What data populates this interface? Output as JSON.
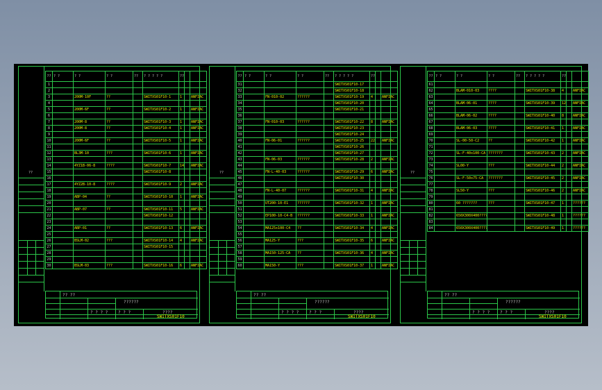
{
  "header": {
    "no": "??",
    "c1": "? ?",
    "c2": "? ?",
    "c3": "? ?",
    "c4": "??",
    "c5": "? ? ? ? ?",
    "c5b": "? ?   ? ?",
    "c6": "?? ??"
  },
  "left_label": "??",
  "title": {
    "name": "??????",
    "sub": "????",
    "code": "SWITXS01F10",
    "row1": "?? ??",
    "row2": "? ? ? ?",
    "row3": "? ? ?"
  },
  "sheets": [
    {
      "rows": [
        {
          "n": "1",
          "a": "",
          "b": "",
          "c": "",
          "d": "",
          "e": ""
        },
        {
          "n": "2",
          "a": "",
          "b": "",
          "c": "",
          "d": "",
          "e": ""
        },
        {
          "n": "3",
          "a": "200M-10F",
          "b": "??",
          "c": "SWITXS01F10-1",
          "d": "1",
          "e": "ANFIAC"
        },
        {
          "n": "4",
          "a": "",
          "b": "",
          "c": "",
          "d": "",
          "e": ""
        },
        {
          "n": "5",
          "a": "200M-6F",
          "b": "??",
          "c": "SWITXS01F10-2",
          "d": "1",
          "e": "ANFIAC"
        },
        {
          "n": "6",
          "a": "",
          "b": "",
          "c": "",
          "d": "",
          "e": ""
        },
        {
          "n": "7",
          "a": "200M-8",
          "b": "??",
          "c": "SWITXS01F10-3",
          "d": "1",
          "e": "ANFIAC"
        },
        {
          "n": "8",
          "a": "200M-8",
          "b": "??",
          "c": "SWITXS01F10-4",
          "d": "1",
          "e": "ANFIAC"
        },
        {
          "n": "9",
          "a": "",
          "b": "",
          "c": "",
          "d": "",
          "e": ""
        },
        {
          "n": "10",
          "a": "200M-6F",
          "b": "??",
          "c": "SWITXS01F10-5",
          "d": "1",
          "e": "ANFIAC"
        },
        {
          "n": "11",
          "a": "",
          "b": "",
          "c": "",
          "d": "",
          "e": ""
        },
        {
          "n": "12",
          "a": "BL3M-10",
          "b": "???",
          "c": "SWITXS01F10-6",
          "d": "1",
          "e": "ANFIAC"
        },
        {
          "n": "13",
          "a": "",
          "b": "",
          "c": "",
          "d": "",
          "e": ""
        },
        {
          "n": "14",
          "a": "4YZ1B-06-8",
          "b": "????",
          "c": "SWITXS01F10-7",
          "d": "14",
          "e": "ANFIAC"
        },
        {
          "n": "15",
          "a": "",
          "b": "",
          "c": "SWITXS01F10-8",
          "d": "",
          "e": ""
        },
        {
          "n": "16",
          "a": "",
          "b": "",
          "c": "",
          "d": "",
          "e": ""
        },
        {
          "n": "17",
          "a": "4YZ2B-10-8",
          "b": "????",
          "c": "SWITXS01F10-9",
          "d": "2",
          "e": "ANFIAC"
        },
        {
          "n": "18",
          "a": "",
          "b": "",
          "c": "",
          "d": "",
          "e": ""
        },
        {
          "n": "19",
          "a": "ABP-04",
          "b": "??",
          "c": "SWITXS01F10-10",
          "d": "1",
          "e": "ANFIAC"
        },
        {
          "n": "20",
          "a": "",
          "b": "",
          "c": "",
          "d": "",
          "e": ""
        },
        {
          "n": "21",
          "a": "ABP-07",
          "b": "??",
          "c": "SWITXS01F10-11",
          "d": "5",
          "e": "ANFIAC"
        },
        {
          "n": "22",
          "a": "",
          "b": "",
          "c": "SWITXS01F10-12",
          "d": "",
          "e": ""
        },
        {
          "n": "23",
          "a": "",
          "b": "",
          "c": "",
          "d": "",
          "e": ""
        },
        {
          "n": "24",
          "a": "ABP-01",
          "b": "??",
          "c": "SWITXS01F10-13",
          "d": "6",
          "e": "ANFIAC"
        },
        {
          "n": "25",
          "a": "",
          "b": "",
          "c": "",
          "d": "",
          "e": ""
        },
        {
          "n": "26",
          "a": "BSLM-02",
          "b": "???",
          "c": "SWITXS01F10-14",
          "d": "4",
          "e": "ANFIAC"
        },
        {
          "n": "27",
          "a": "",
          "b": "",
          "c": "SWITXS01F10-15",
          "d": "",
          "e": ""
        },
        {
          "n": "28",
          "a": "",
          "b": "",
          "c": "",
          "d": "",
          "e": ""
        },
        {
          "n": "29",
          "a": "",
          "b": "",
          "c": "",
          "d": "",
          "e": ""
        },
        {
          "n": "30",
          "a": "BSLM-03",
          "b": "???",
          "c": "SWITXS01F10-16",
          "d": "6",
          "e": "ANFIAC"
        }
      ]
    },
    {
      "rows": [
        {
          "n": "31",
          "a": "",
          "b": "",
          "c": "SWITXS01F10-17",
          "d": "",
          "e": ""
        },
        {
          "n": "32",
          "a": "",
          "b": "",
          "c": "SWITXS01F10-18",
          "d": "",
          "e": ""
        },
        {
          "n": "33",
          "a": "FN-010-02",
          "b": "??????",
          "c": "SWITXS01F10-19",
          "d": "4",
          "e": "ANFIAC"
        },
        {
          "n": "34",
          "a": "",
          "b": "",
          "c": "SWITXS01F10-20",
          "d": "",
          "e": ""
        },
        {
          "n": "35",
          "a": "",
          "b": "",
          "c": "SWITXS01F10-21",
          "d": "",
          "e": ""
        },
        {
          "n": "36",
          "a": "",
          "b": "",
          "c": "",
          "d": "",
          "e": ""
        },
        {
          "n": "37",
          "a": "FN-010-03",
          "b": "??????",
          "c": "SWITXS01F10-22",
          "d": "8",
          "e": "ANFIAC"
        },
        {
          "n": "38",
          "a": "",
          "b": "",
          "c": "SWITXS01F10-23",
          "d": "",
          "e": ""
        },
        {
          "n": "39",
          "a": "",
          "b": "",
          "c": "SWITXS01F10-24",
          "d": "",
          "e": ""
        },
        {
          "n": "40",
          "a": "FN-06-01",
          "b": "??????",
          "c": "SWITXS01F10-25",
          "d": "22",
          "e": "ANFIAC"
        },
        {
          "n": "41",
          "a": "",
          "b": "",
          "c": "SWITXS01F10-26",
          "d": "",
          "e": ""
        },
        {
          "n": "42",
          "a": "",
          "b": "",
          "c": "SWITXS01F10-27",
          "d": "",
          "e": ""
        },
        {
          "n": "43",
          "a": "FN-06-03",
          "b": "??????",
          "c": "SWITXS01F10-28",
          "d": "2",
          "e": "ANFIAC"
        },
        {
          "n": "44",
          "a": "",
          "b": "",
          "c": "",
          "d": "",
          "e": ""
        },
        {
          "n": "45",
          "a": "FN-L-40-03",
          "b": "??????",
          "c": "SWITXS01F10-29",
          "d": "6",
          "e": "ANFIAC"
        },
        {
          "n": "46",
          "a": "",
          "b": "",
          "c": "SWITXS01F10-30",
          "d": "",
          "e": ""
        },
        {
          "n": "47",
          "a": "",
          "b": "",
          "c": "",
          "d": "",
          "e": ""
        },
        {
          "n": "48",
          "a": "FN-L-40-07",
          "b": "??????",
          "c": "SWITXS01F10-31",
          "d": "4",
          "e": "ANFIAC"
        },
        {
          "n": "49",
          "a": "",
          "b": "",
          "c": "",
          "d": "",
          "e": ""
        },
        {
          "n": "50",
          "a": "UT200-10-E1",
          "b": "??????",
          "c": "SWITXS01F10-32",
          "d": "1",
          "e": "ANFIAC"
        },
        {
          "n": "51",
          "a": "",
          "b": "",
          "c": "",
          "d": "",
          "e": ""
        },
        {
          "n": "52",
          "a": "EP100-10-C4-B",
          "b": "??????",
          "c": "SWITXS01F10-33",
          "d": "1",
          "e": "ANFIAC"
        },
        {
          "n": "53",
          "a": "",
          "b": "",
          "c": "",
          "d": "",
          "e": ""
        },
        {
          "n": "54",
          "a": "MA125x100-C4",
          "b": "??",
          "c": "SWITXS01F10-34",
          "d": "4",
          "e": "ANFIAC"
        },
        {
          "n": "55",
          "a": "",
          "b": "",
          "c": "",
          "d": "",
          "e": ""
        },
        {
          "n": "56",
          "a": "MA125-Y",
          "b": "???",
          "c": "SWITXS01F10-35",
          "d": "6",
          "e": "ANFIAC"
        },
        {
          "n": "57",
          "a": "",
          "b": "",
          "c": "",
          "d": "",
          "e": ""
        },
        {
          "n": "58",
          "a": "MA150-125-CA",
          "b": "??",
          "c": "SWITXS01F10-36",
          "d": "4",
          "e": "ANFIAC"
        },
        {
          "n": "59",
          "a": "",
          "b": "",
          "c": "",
          "d": "",
          "e": ""
        },
        {
          "n": "60",
          "a": "MA150-Y",
          "b": "???",
          "c": "SWITXS01F10-37",
          "d": "1",
          "e": "ANFIAC"
        }
      ]
    },
    {
      "rows": [
        {
          "n": "61",
          "a": "",
          "b": "",
          "c": "",
          "d": "",
          "e": ""
        },
        {
          "n": "62",
          "a": "BLAM-010-03",
          "b": "????",
          "c": "SWITXS01F10-38",
          "d": "4",
          "e": "ANFIAC"
        },
        {
          "n": "63",
          "a": "",
          "b": "",
          "c": "",
          "d": "",
          "e": ""
        },
        {
          "n": "64",
          "a": "BLAM-06-01",
          "b": "????",
          "c": "SWITXS01F10-39",
          "d": "12",
          "e": "ANFIAC"
        },
        {
          "n": "65",
          "a": "",
          "b": "",
          "c": "",
          "d": "",
          "e": ""
        },
        {
          "n": "66",
          "a": "BLAM-06-02",
          "b": "????",
          "c": "SWITXS01F10-40",
          "d": "8",
          "e": "ANFIAC"
        },
        {
          "n": "67",
          "a": "",
          "b": "",
          "c": "",
          "d": "",
          "e": ""
        },
        {
          "n": "68",
          "a": "BLAM-06-03",
          "b": "????",
          "c": "SWITXS01F10-41",
          "d": "1",
          "e": "ANFIAC"
        },
        {
          "n": "69",
          "a": "",
          "b": "",
          "c": "",
          "d": "",
          "e": ""
        },
        {
          "n": "70",
          "a": "SL-00-50-C2",
          "b": "??",
          "c": "SWITXS01F10-42",
          "d": "1",
          "e": "ANFIAC"
        },
        {
          "n": "71",
          "a": "",
          "b": "",
          "c": "",
          "d": "",
          "e": ""
        },
        {
          "n": "72",
          "a": "SL-F-40x100-CA",
          "b": "???????",
          "c": "SWITXS01F10-43",
          "d": "2",
          "e": "ANFIAC"
        },
        {
          "n": "73",
          "a": "",
          "b": "",
          "c": "",
          "d": "",
          "e": ""
        },
        {
          "n": "74",
          "a": "SL00-Y",
          "b": "???",
          "c": "SWITXS01F10-44",
          "d": "2",
          "e": "ANFIAC"
        },
        {
          "n": "75",
          "a": "",
          "b": "",
          "c": "",
          "d": "",
          "e": ""
        },
        {
          "n": "76",
          "a": "SL-F-50x75-CA",
          "b": "???????",
          "c": "SWITXS01F10-45",
          "d": "2",
          "e": "ANFIAC"
        },
        {
          "n": "77",
          "a": "",
          "b": "",
          "c": "",
          "d": "",
          "e": ""
        },
        {
          "n": "78",
          "a": "SL50-Y",
          "b": "???",
          "c": "SWITXS01F10-46",
          "d": "2",
          "e": "ANFIAC"
        },
        {
          "n": "79",
          "a": "",
          "b": "",
          "c": "",
          "d": "",
          "e": ""
        },
        {
          "n": "80",
          "a": "60 ???????",
          "b": "???",
          "c": "SWITXS01F10-47",
          "d": "1",
          "e": "??????"
        },
        {
          "n": "81",
          "a": "",
          "b": "",
          "c": "",
          "d": "",
          "e": ""
        },
        {
          "n": "82",
          "a": "650X300X400????",
          "b": "",
          "c": "SWITXS01F10-48",
          "d": "1",
          "e": "??????"
        },
        {
          "n": "83",
          "a": "",
          "b": "",
          "c": "",
          "d": "",
          "e": ""
        },
        {
          "n": "84",
          "a": "650X300X400????",
          "b": "",
          "c": "SWITXS01F10-49",
          "d": "1",
          "e": "??????"
        }
      ]
    }
  ]
}
